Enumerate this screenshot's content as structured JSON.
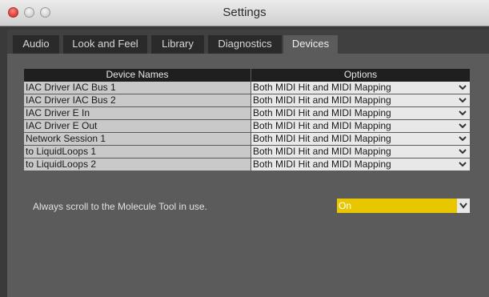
{
  "window": {
    "title": "Settings"
  },
  "tabs": [
    {
      "label": "Audio"
    },
    {
      "label": "Look and Feel"
    },
    {
      "label": "Library"
    },
    {
      "label": "Diagnostics"
    },
    {
      "label": "Devices"
    }
  ],
  "active_tab": "Devices",
  "devices_table": {
    "headers": {
      "names": "Device Names",
      "options": "Options"
    },
    "rows": [
      {
        "name": "IAC Driver IAC Bus 1",
        "option": "Both MIDI Hit and MIDI Mapping"
      },
      {
        "name": "IAC Driver IAC Bus 2",
        "option": "Both MIDI Hit and MIDI Mapping"
      },
      {
        "name": "IAC Driver E In",
        "option": "Both MIDI Hit and MIDI Mapping"
      },
      {
        "name": "IAC Driver E Out",
        "option": "Both MIDI Hit and MIDI Mapping"
      },
      {
        "name": "Network Session 1",
        "option": "Both MIDI Hit and MIDI Mapping"
      },
      {
        "name": "to LiquidLoops 1",
        "option": "Both MIDI Hit and MIDI Mapping"
      },
      {
        "name": "to LiquidLoops 2",
        "option": "Both MIDI Hit and MIDI Mapping"
      }
    ]
  },
  "scroll_setting": {
    "label": "Always scroll to the Molecule Tool in use.",
    "value": "On"
  },
  "colors": {
    "window_bg": "#3a3a3a",
    "panel_bg": "#5b5b5b",
    "selected_value_bg": "#e8c700",
    "header_bg": "#1f1f1f"
  },
  "icons": {
    "dropdown": "chevron-down-icon",
    "close": "close-dot-icon",
    "minimize": "minimize-dot-icon",
    "zoom": "zoom-dot-icon"
  }
}
